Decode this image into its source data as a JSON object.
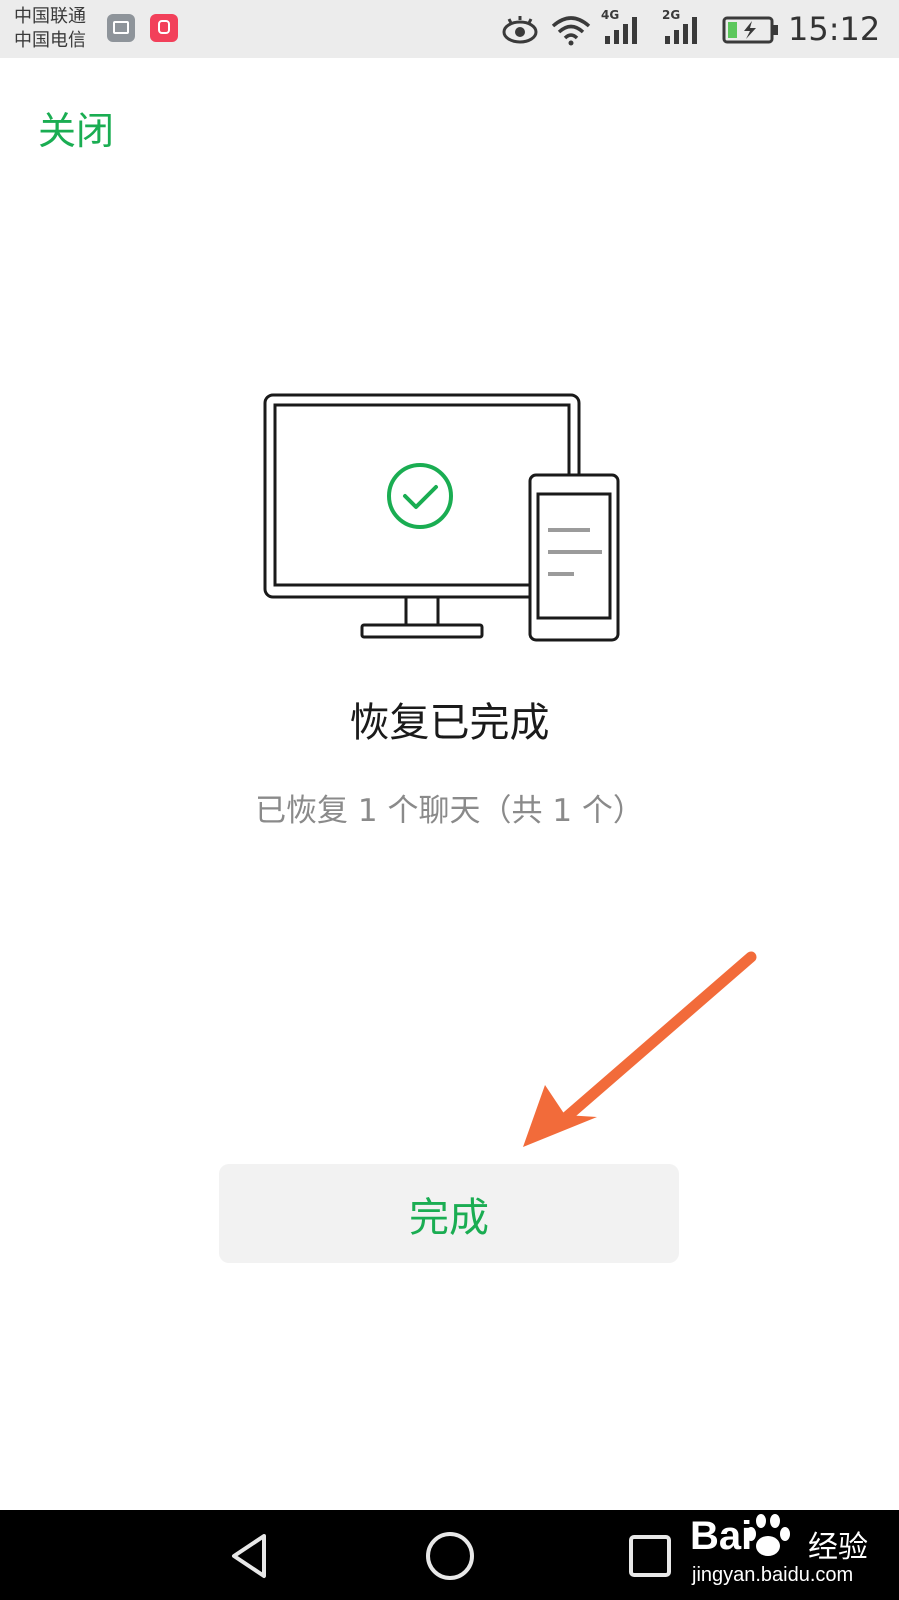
{
  "status_bar": {
    "carrier_1": "中国联通",
    "carrier_2": "中国电信",
    "network_1": "4G",
    "network_2": "2G",
    "time": "15:12",
    "icons": [
      "gallery-icon",
      "kuaishou-app-icon",
      "eye-comfort-icon",
      "wifi-icon",
      "signal-icon",
      "signal-icon",
      "battery-charging-icon"
    ]
  },
  "header": {
    "close_label": "关闭"
  },
  "illustration": {
    "icons": [
      "monitor-icon",
      "phone-icon",
      "check-circle-icon"
    ]
  },
  "content": {
    "title": "恢复已完成",
    "subtitle": "已恢复 1 个聊天（共 1 个）"
  },
  "actions": {
    "done_label": "完成"
  },
  "annotation": {
    "arrow_color": "#f26b3a"
  },
  "nav_bar": {
    "icons": [
      "back-icon",
      "home-icon",
      "recent-apps-icon"
    ]
  },
  "watermark": {
    "brand": "Bai",
    "brand_suffix": "经验",
    "url": "jingyan.baidu.com"
  },
  "colors": {
    "accent_green": "#1aad52",
    "button_bg": "#f2f2f2",
    "status_bar_bg": "#ececec",
    "nav_bar_bg": "#000000"
  }
}
